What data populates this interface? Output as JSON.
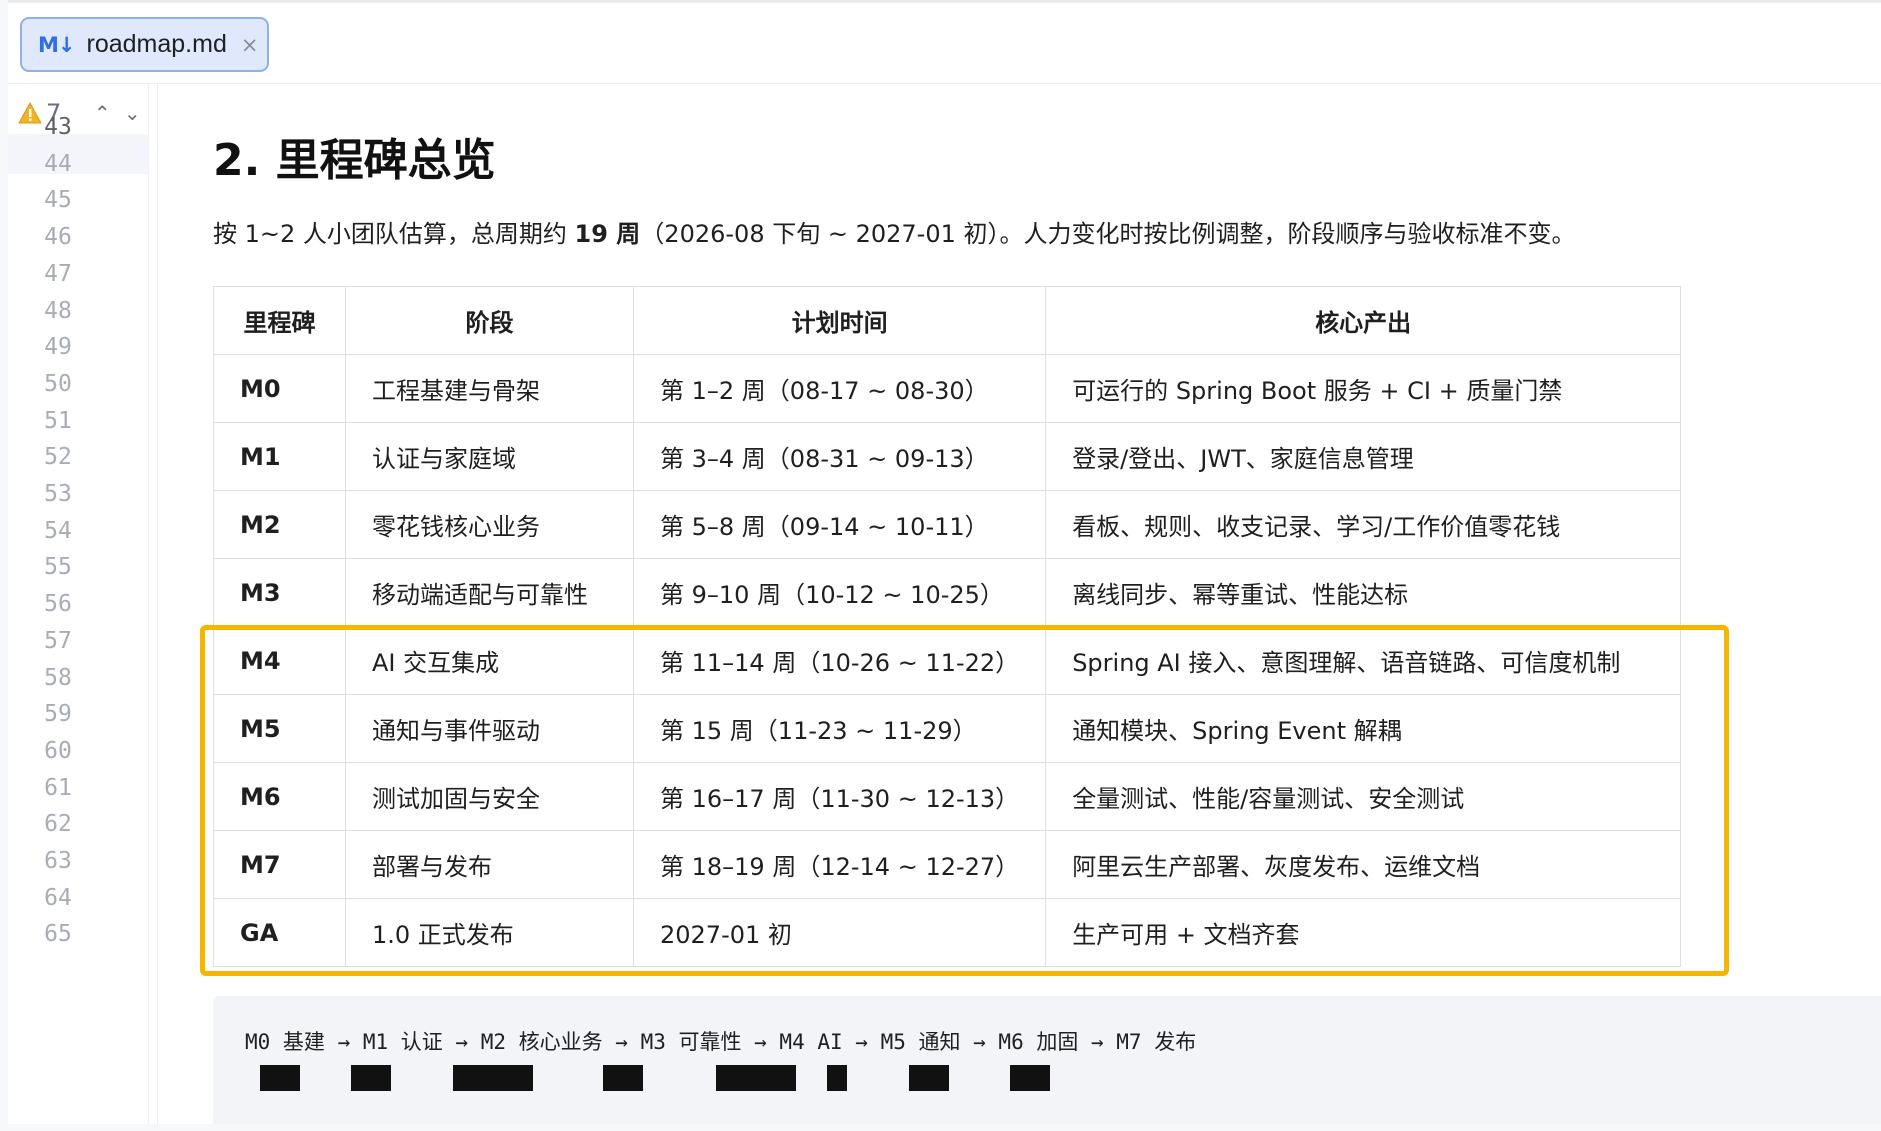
{
  "tab": {
    "icon": "M↓",
    "label": "roadmap.md",
    "close": "×"
  },
  "inspection": {
    "warning_count": "7",
    "prev_arrow": "⌃",
    "next_arrow": "⌄"
  },
  "gutter": {
    "line_numbers": [
      "43",
      "44",
      "45",
      "46",
      "47",
      "48",
      "49",
      "50",
      "51",
      "52",
      "53",
      "54",
      "55",
      "56",
      "57",
      "58",
      "59",
      "60",
      "61",
      "62",
      "63",
      "64",
      "65"
    ]
  },
  "document": {
    "heading": "2. 里程碑总览",
    "intro_prefix": "按 1~2 人小团队估算，总周期约 ",
    "intro_bold": "19 周",
    "intro_suffix": "（2026-08 下旬 ~ 2027-01 初）。人力变化时按比例调整，阶段顺序与验收标准不变。",
    "table": {
      "headers": [
        "里程碑",
        "阶段",
        "计划时间",
        "核心产出"
      ],
      "rows": [
        {
          "id": "M0",
          "phase": "工程基建与骨架",
          "time": "第 1–2 周（08-17 ~ 08-30）",
          "output": "可运行的 Spring Boot 服务 + CI + 质量门禁"
        },
        {
          "id": "M1",
          "phase": "认证与家庭域",
          "time": "第 3–4 周（08-31 ~ 09-13）",
          "output": "登录/登出、JWT、家庭信息管理"
        },
        {
          "id": "M2",
          "phase": "零花钱核心业务",
          "time": "第 5–8 周（09-14 ~ 10-11）",
          "output": "看板、规则、收支记录、学习/工作价值零花钱"
        },
        {
          "id": "M3",
          "phase": "移动端适配与可靠性",
          "time": "第 9–10 周（10-12 ~ 10-25）",
          "output": "离线同步、幂等重试、性能达标"
        },
        {
          "id": "M4",
          "phase": "AI 交互集成",
          "time": "第 11–14 周（10-26 ~ 11-22）",
          "output": "Spring AI 接入、意图理解、语音链路、可信度机制"
        },
        {
          "id": "M5",
          "phase": "通知与事件驱动",
          "time": "第 15 周（11-23 ~ 11-29）",
          "output": "通知模块、Spring Event 解耦"
        },
        {
          "id": "M6",
          "phase": "测试加固与安全",
          "time": "第 16–17 周（11-30 ~ 12-13）",
          "output": "全量测试、性能/容量测试、安全测试"
        },
        {
          "id": "M7",
          "phase": "部署与发布",
          "time": "第 18–19 周（12-14 ~ 12-27）",
          "output": "阿里云生产部署、灰度发布、运维文档"
        },
        {
          "id": "GA",
          "phase": "1.0 正式发布",
          "time": "2027-01 初",
          "output": "生产可用 + 文档齐套"
        }
      ]
    },
    "flow_line": "M0 基建 → M1 认证 → M2 核心业务 → M3 可靠性 → M4 AI → M5 通知 → M6 加固 → M7 发布",
    "flow_bars": [
      2,
      2,
      4,
      2,
      4,
      1,
      2,
      2
    ]
  },
  "colors": {
    "highlight_border": "#f7b500",
    "tab_background": "#dfe9fb",
    "tab_border": "#8fb0ea",
    "markdown_icon": "#2f6fde",
    "warning": "#f0b429"
  }
}
